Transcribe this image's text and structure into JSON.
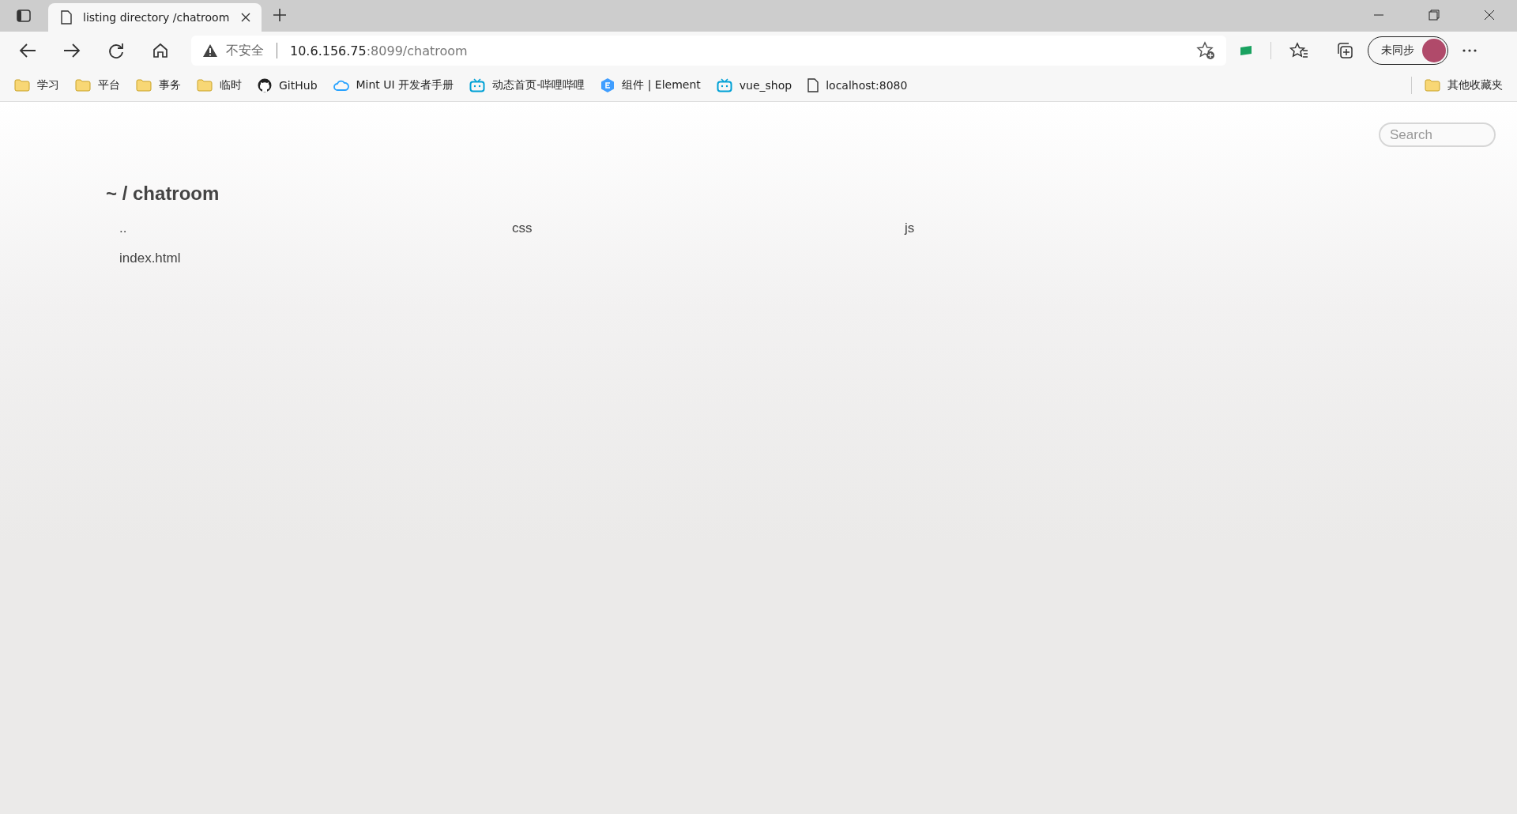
{
  "tab": {
    "title": "listing directory /chatroom",
    "selected": true
  },
  "address_bar": {
    "security": "不安全",
    "host": "10.6.156.75",
    "rest": ":8099/chatroom"
  },
  "profile": {
    "label": "未同步"
  },
  "bookmarks": [
    {
      "kind": "folder",
      "label": "学习"
    },
    {
      "kind": "folder",
      "label": "平台"
    },
    {
      "kind": "folder",
      "label": "事务"
    },
    {
      "kind": "folder",
      "label": "临时"
    },
    {
      "kind": "github",
      "label": "GitHub"
    },
    {
      "kind": "cloud",
      "label": "Mint UI 开发者手册"
    },
    {
      "kind": "tv",
      "label": "动态首页-哔哩哔哩"
    },
    {
      "kind": "shield",
      "label": "组件 | Element"
    },
    {
      "kind": "tv",
      "label": "vue_shop"
    },
    {
      "kind": "page",
      "label": "localhost:8080"
    }
  ],
  "other_bookmarks": {
    "label": "其他收藏夹"
  },
  "page": {
    "search": {
      "placeholder": "Search"
    },
    "heading": "~ / chatroom",
    "files": [
      {
        "name": ".."
      },
      {
        "name": "css"
      },
      {
        "name": "js"
      },
      {
        "name": "index.html"
      }
    ]
  }
}
